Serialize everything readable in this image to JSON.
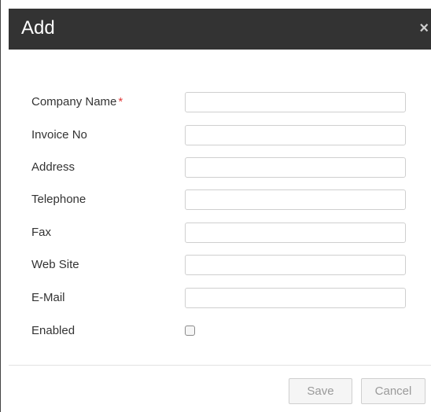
{
  "dialog": {
    "title": "Add",
    "close_glyph": "×"
  },
  "form": {
    "fields": [
      {
        "label": "Company Name",
        "required": true,
        "required_mark": "*",
        "value": ""
      },
      {
        "label": "Invoice No",
        "value": ""
      },
      {
        "label": "Address",
        "value": ""
      },
      {
        "label": "Telephone",
        "value": ""
      },
      {
        "label": "Fax",
        "value": ""
      },
      {
        "label": "Web Site",
        "value": ""
      },
      {
        "label": "E-Mail",
        "value": ""
      }
    ],
    "enabled": {
      "label": "Enabled",
      "checked": false
    }
  },
  "footer": {
    "save_label": "Save",
    "cancel_label": "Cancel"
  },
  "colors": {
    "titlebar": "#333333",
    "required": "#e03a3a"
  }
}
